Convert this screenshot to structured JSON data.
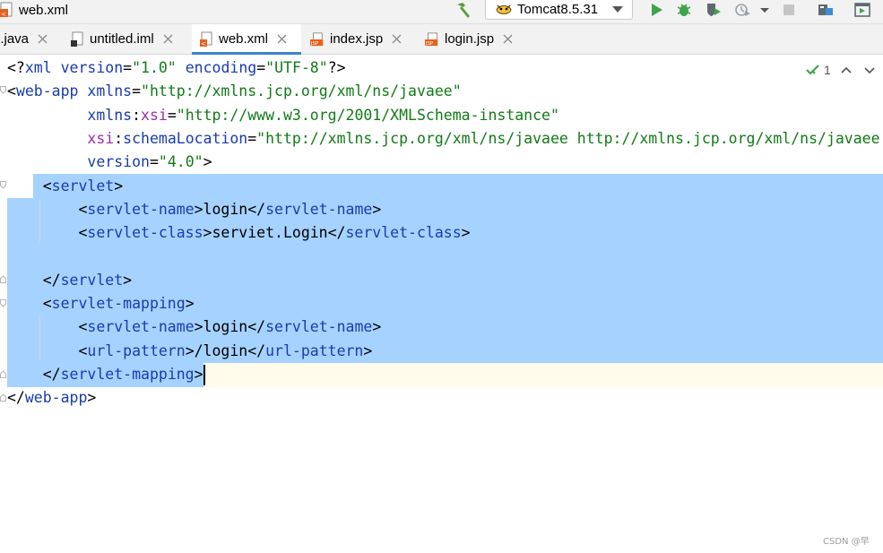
{
  "window": {
    "title": "web.xml"
  },
  "toolbar": {
    "run_config": "Tomcat8.5.31",
    "icons": [
      "hammer-icon",
      "run-icon",
      "debug-icon",
      "coverage-icon",
      "profile-icon",
      "stop-icon",
      "project-structure-icon",
      "run-window-icon"
    ]
  },
  "tabs": [
    {
      "label": "n.java",
      "active": false
    },
    {
      "label": "untitled.iml",
      "active": false
    },
    {
      "label": "web.xml",
      "active": true
    },
    {
      "label": "index.jsp",
      "active": false
    },
    {
      "label": "login.jsp",
      "active": false
    }
  ],
  "editor": {
    "inspection_count": "1",
    "lines": [
      [
        {
          "c": "k",
          "t": "<?"
        },
        {
          "c": "t",
          "t": "xml "
        },
        {
          "c": "a",
          "t": "version"
        },
        {
          "c": "k",
          "t": "="
        },
        {
          "c": "v",
          "t": "\"1.0\""
        },
        {
          "c": "k",
          "t": " "
        },
        {
          "c": "a",
          "t": "encoding"
        },
        {
          "c": "k",
          "t": "="
        },
        {
          "c": "v",
          "t": "\"UTF-8\""
        },
        {
          "c": "k",
          "t": "?>"
        }
      ],
      [
        {
          "c": "k",
          "t": "<"
        },
        {
          "c": "t",
          "t": "web-app"
        },
        {
          "c": "k",
          "t": " "
        },
        {
          "c": "a",
          "t": "xmlns"
        },
        {
          "c": "k",
          "t": "="
        },
        {
          "c": "v",
          "t": "\"http://xmlns.jcp.org/xml/ns/javaee\""
        }
      ],
      [
        {
          "c": "k",
          "t": "         "
        },
        {
          "c": "a",
          "t": "xmlns"
        },
        {
          "c": "k",
          "t": ":"
        },
        {
          "c": "p",
          "t": "xsi"
        },
        {
          "c": "k",
          "t": "="
        },
        {
          "c": "v",
          "t": "\"http://www.w3.org/2001/XMLSchema-instance\""
        }
      ],
      [
        {
          "c": "k",
          "t": "         "
        },
        {
          "c": "p",
          "t": "xsi"
        },
        {
          "c": "k",
          "t": ":"
        },
        {
          "c": "a",
          "t": "schemaLocation"
        },
        {
          "c": "k",
          "t": "="
        },
        {
          "c": "v",
          "t": "\"http://xmlns.jcp.org/xml/ns/javaee http://xmlns.jcp.org/xml/ns/javaee"
        }
      ],
      [
        {
          "c": "k",
          "t": "         "
        },
        {
          "c": "a",
          "t": "version"
        },
        {
          "c": "k",
          "t": "="
        },
        {
          "c": "v",
          "t": "\"4.0\""
        },
        {
          "c": "k",
          "t": ">"
        }
      ],
      [
        {
          "c": "k",
          "t": "    <"
        },
        {
          "c": "t",
          "t": "servlet"
        },
        {
          "c": "k",
          "t": ">"
        }
      ],
      [
        {
          "c": "k",
          "t": "        <"
        },
        {
          "c": "t",
          "t": "servlet-name"
        },
        {
          "c": "k",
          "t": ">login</"
        },
        {
          "c": "t",
          "t": "servlet-name"
        },
        {
          "c": "k",
          "t": ">"
        }
      ],
      [
        {
          "c": "k",
          "t": "        <"
        },
        {
          "c": "t",
          "t": "servlet-class"
        },
        {
          "c": "k",
          "t": ">serviet.Login</"
        },
        {
          "c": "t",
          "t": "servlet-class"
        },
        {
          "c": "k",
          "t": ">"
        }
      ],
      [],
      [
        {
          "c": "k",
          "t": "    </"
        },
        {
          "c": "t",
          "t": "servlet"
        },
        {
          "c": "k",
          "t": ">"
        }
      ],
      [
        {
          "c": "k",
          "t": "    <"
        },
        {
          "c": "t",
          "t": "servlet-mapping"
        },
        {
          "c": "k",
          "t": ">"
        }
      ],
      [
        {
          "c": "k",
          "t": "        <"
        },
        {
          "c": "t",
          "t": "servlet-name"
        },
        {
          "c": "k",
          "t": ">login</"
        },
        {
          "c": "t",
          "t": "servlet-name"
        },
        {
          "c": "k",
          "t": ">"
        }
      ],
      [
        {
          "c": "k",
          "t": "        <"
        },
        {
          "c": "t",
          "t": "url-pattern"
        },
        {
          "c": "k",
          "t": ">/login</"
        },
        {
          "c": "t",
          "t": "url-pattern"
        },
        {
          "c": "k",
          "t": ">"
        }
      ],
      [
        {
          "c": "k",
          "t": "    </"
        },
        {
          "c": "t",
          "t": "servlet-mapping"
        },
        {
          "c": "k",
          "t": ">"
        }
      ],
      [
        {
          "c": "k",
          "t": "</"
        },
        {
          "c": "t",
          "t": "web-app"
        },
        {
          "c": "k",
          "t": ">"
        }
      ]
    ]
  },
  "watermark": "CSDN @早",
  "colors": {
    "selection": "#a6d2ff",
    "tag": "#1a3bb0",
    "value": "#117a17",
    "prefix": "#9a2ea6",
    "accent": "#4083c9"
  }
}
